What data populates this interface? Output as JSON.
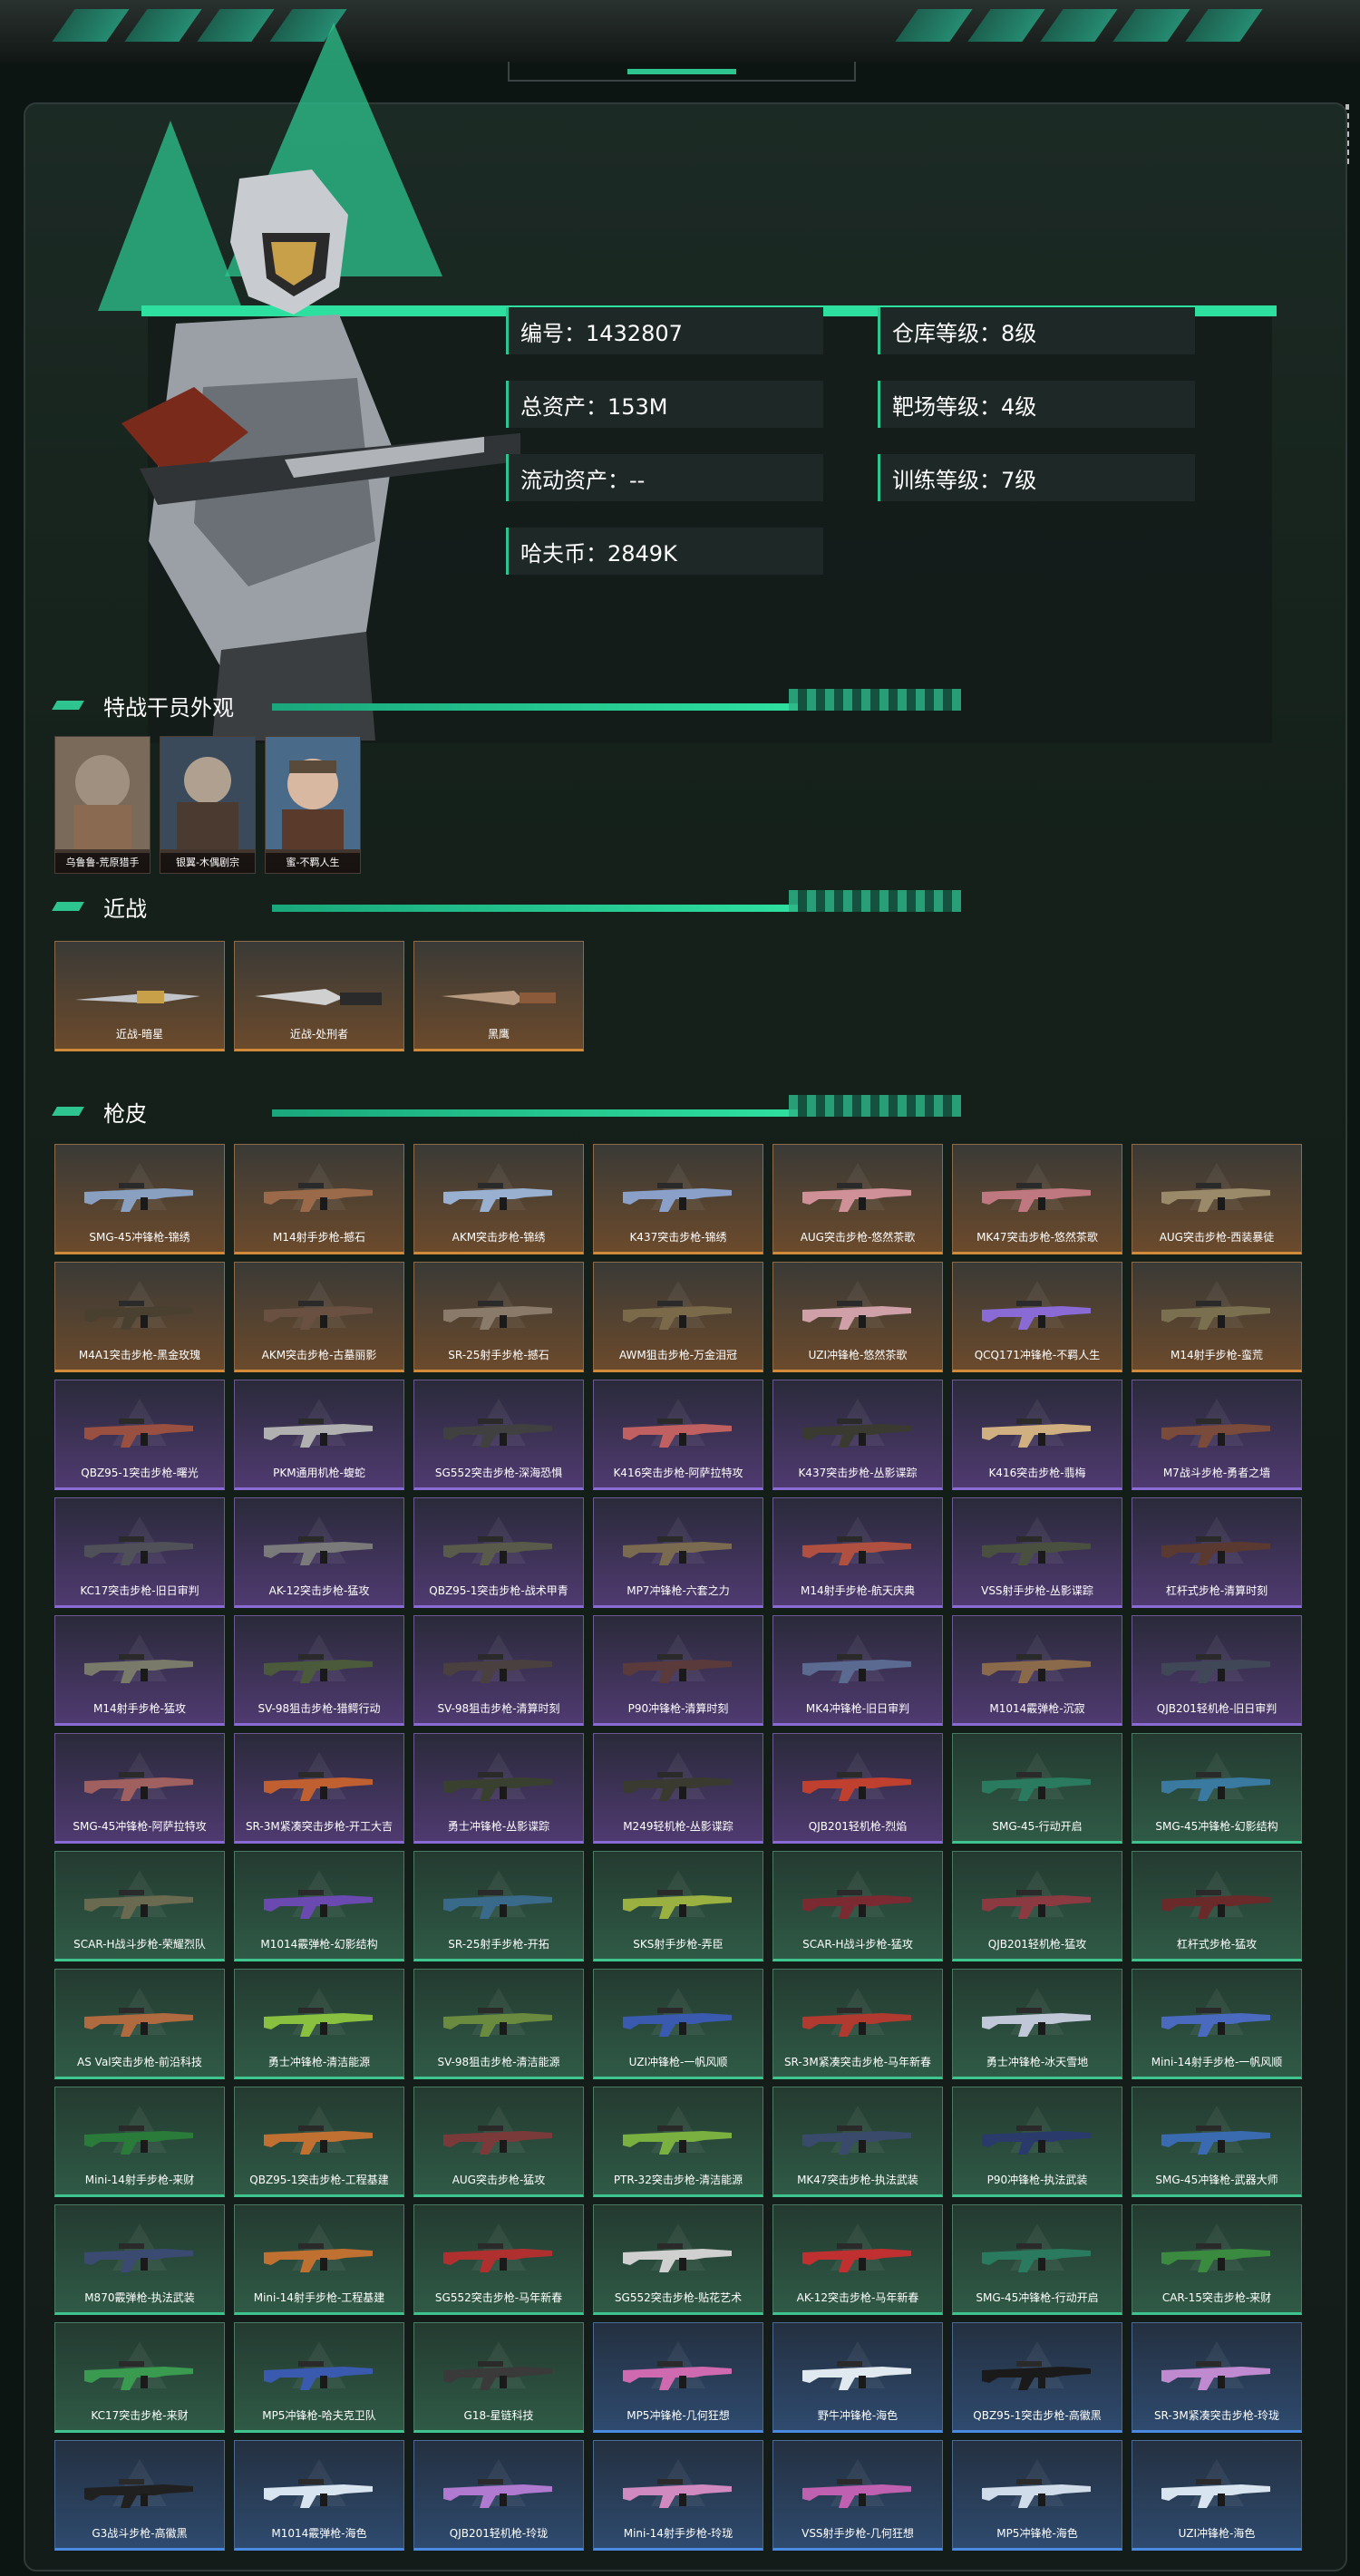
{
  "profile": {
    "stats_left": [
      "编号：1432807",
      "总资产：153M",
      "流动资产：--",
      "哈夫币：2849K"
    ],
    "stats_right": [
      "仓库等级：8级",
      "靶场等级：4级",
      "训练等级：7级"
    ]
  },
  "sections": {
    "operators": "特战干员外观",
    "melee": "近战",
    "skins": "枪皮"
  },
  "operators": [
    "乌鲁鲁-荒原猎手",
    "银翼-木偶剧宗",
    "蜜-不羁人生"
  ],
  "melee": [
    "近战-暗星",
    "近战-处刑者",
    "黑鹰"
  ],
  "skins": [
    {
      "name": "SMG-45冲锋枪-锦绣",
      "tier": "orange",
      "color": "#8aa0c0"
    },
    {
      "name": "M14射手步枪-撼石",
      "tier": "orange",
      "color": "#9a6a4a"
    },
    {
      "name": "AKM突击步枪-锦绣",
      "tier": "orange",
      "color": "#9ab0d0"
    },
    {
      "name": "K437突击步枪-锦绣",
      "tier": "orange",
      "color": "#8aa0c8"
    },
    {
      "name": "AUG突击步枪-悠然茶歌",
      "tier": "orange",
      "color": "#d09098"
    },
    {
      "name": "MK47突击步枪-悠然茶歌",
      "tier": "orange",
      "color": "#c07880"
    },
    {
      "name": "AUG突击步枪-西装暴徒",
      "tier": "orange",
      "color": "#9a8a6a"
    },
    {
      "name": "M4A1突击步枪-黑金玫瑰",
      "tier": "orange",
      "color": "#4a4030"
    },
    {
      "name": "AKM突击步枪-古墓丽影",
      "tier": "orange",
      "color": "#6a5040"
    },
    {
      "name": "SR-25射手步枪-撼石",
      "tier": "orange",
      "color": "#8a7a6a"
    },
    {
      "name": "AWM狙击步枪-万金泪冠",
      "tier": "orange",
      "color": "#7a6a4a"
    },
    {
      "name": "UZI冲锋枪-悠然茶歌",
      "tier": "orange",
      "color": "#d0a0a8"
    },
    {
      "name": "QCQ171冲锋枪-不羁人生",
      "tier": "orange",
      "color": "#8a6ad4"
    },
    {
      "name": "M14射手步枪-蛮荒",
      "tier": "orange",
      "color": "#7a7050"
    },
    {
      "name": "QBZ95-1突击步枪-曙光",
      "tier": "purple",
      "color": "#9a5040"
    },
    {
      "name": "PKM通用机枪-蝮蛇",
      "tier": "purple",
      "color": "#b0b0b0"
    },
    {
      "name": "SG552突击步枪-深海恐惧",
      "tier": "purple",
      "color": "#404040"
    },
    {
      "name": "K416突击步枪-阿萨拉特攻",
      "tier": "purple",
      "color": "#c06060"
    },
    {
      "name": "K437突击步枪-丛影谍踪",
      "tier": "purple",
      "color": "#3a3a30"
    },
    {
      "name": "K416突击步枪-翡梅",
      "tier": "purple",
      "color": "#d0b080"
    },
    {
      "name": "M7战斗步枪-勇者之墙",
      "tier": "purple",
      "color": "#7a4a3a"
    },
    {
      "name": "KC17突击步枪-旧日审判",
      "tier": "purple",
      "color": "#505058"
    },
    {
      "name": "AK-12突击步枪-猛攻",
      "tier": "purple",
      "color": "#7a7a7a"
    },
    {
      "name": "QBZ95-1突击步枪-战术甲青",
      "tier": "purple",
      "color": "#5a5a4a"
    },
    {
      "name": "MP7冲锋枪-六套之力",
      "tier": "purple",
      "color": "#7a6a50"
    },
    {
      "name": "M14射手步枪-航天庆典",
      "tier": "purple",
      "color": "#b05040"
    },
    {
      "name": "VSS射手步枪-丛影谍踪",
      "tier": "purple",
      "color": "#4a5040"
    },
    {
      "name": "杠杆式步枪-清算时刻",
      "tier": "purple",
      "color": "#5a3a30"
    },
    {
      "name": "M14射手步枪-猛攻",
      "tier": "purple",
      "color": "#7a7a6a"
    },
    {
      "name": "SV-98狙击步枪-猎鳄行动",
      "tier": "purple",
      "color": "#4a5a3a"
    },
    {
      "name": "SV-98狙击步枪-清算时刻",
      "tier": "purple",
      "color": "#4a4040"
    },
    {
      "name": "P90冲锋枪-清算时刻",
      "tier": "purple",
      "color": "#5a3a3a"
    },
    {
      "name": "MK4冲锋枪-旧日审判",
      "tier": "purple",
      "color": "#5a6a90"
    },
    {
      "name": "M1014霰弹枪-沉寂",
      "tier": "purple",
      "color": "#8a6a4a"
    },
    {
      "name": "QJB201轻机枪-旧日审判",
      "tier": "purple",
      "color": "#404858"
    },
    {
      "name": "SMG-45冲锋枪-阿萨拉特攻",
      "tier": "purple",
      "color": "#a06060"
    },
    {
      "name": "SR-3M紧凑突击步枪-开工大吉",
      "tier": "purple",
      "color": "#c06030"
    },
    {
      "name": "勇士冲锋枪-丛影谍踪",
      "tier": "purple",
      "color": "#3a4030"
    },
    {
      "name": "M249轻机枪-丛影谍踪",
      "tier": "purple",
      "color": "#3a3a30"
    },
    {
      "name": "QJB201轻机枪-烈焰",
      "tier": "purple",
      "color": "#c04030"
    },
    {
      "name": "SMG-45-行动开启",
      "tier": "green",
      "color": "#2a7a60"
    },
    {
      "name": "SMG-45冲锋枪-幻影结构",
      "tier": "green",
      "color": "#3a7aa0"
    },
    {
      "name": "SCAR-H战斗步枪-荣耀烈队",
      "tier": "green",
      "color": "#6a6a50"
    },
    {
      "name": "M1014霰弹枪-幻影结构",
      "tier": "green",
      "color": "#6a4ab0"
    },
    {
      "name": "SR-25射手步枪-开拓",
      "tier": "green",
      "color": "#3a6a8a"
    },
    {
      "name": "SKS射手步枪-弄臣",
      "tier": "green",
      "color": "#9ab040"
    },
    {
      "name": "SCAR-H战斗步枪-猛攻",
      "tier": "green",
      "color": "#7a2a30"
    },
    {
      "name": "QJB201轻机枪-猛攻",
      "tier": "green",
      "color": "#8a3a40"
    },
    {
      "name": "杠杆式步枪-猛攻",
      "tier": "green",
      "color": "#6a2a2a"
    },
    {
      "name": "AS Val突击步枪-前沿科技",
      "tier": "green",
      "color": "#b06a40"
    },
    {
      "name": "勇士冲锋枪-清洁能源",
      "tier": "green",
      "color": "#8ac040"
    },
    {
      "name": "SV-98狙击步枪-清洁能源",
      "tier": "green",
      "color": "#6a8a40"
    },
    {
      "name": "UZI冲锋枪-一帆风顺",
      "tier": "green",
      "color": "#3a5ab0"
    },
    {
      "name": "SR-3M紧凑突击步枪-马年新春",
      "tier": "green",
      "color": "#b03a30"
    },
    {
      "name": "勇士冲锋枪-冰天雪地",
      "tier": "green",
      "color": "#c0c8d8"
    },
    {
      "name": "Mini-14射手步枪-一帆风顺",
      "tier": "green",
      "color": "#4a6ac0"
    },
    {
      "name": "Mini-14射手步枪-来财",
      "tier": "green",
      "color": "#2a7a3a"
    },
    {
      "name": "QBZ95-1突击步枪-工程基建",
      "tier": "green",
      "color": "#c07030"
    },
    {
      "name": "AUG突击步枪-猛攻",
      "tier": "green",
      "color": "#7a3a3a"
    },
    {
      "name": "PTR-32突击步枪-清洁能源",
      "tier": "green",
      "color": "#7ab040"
    },
    {
      "name": "MK47突击步枪-执法武装",
      "tier": "green",
      "color": "#3a4a6a"
    },
    {
      "name": "P90冲锋枪-执法武装",
      "tier": "green",
      "color": "#2a3a6a"
    },
    {
      "name": "SMG-45冲锋枪-武器大师",
      "tier": "green",
      "color": "#3a6ab0"
    },
    {
      "name": "M870霰弹枪-执法武装",
      "tier": "green",
      "color": "#3a4a70"
    },
    {
      "name": "Mini-14射手步枪-工程基建",
      "tier": "green",
      "color": "#c07030"
    },
    {
      "name": "SG552突击步枪-马年新春",
      "tier": "green",
      "color": "#b03030"
    },
    {
      "name": "SG552突击步枪-贴花艺术",
      "tier": "green",
      "color": "#d0d0d0"
    },
    {
      "name": "AK-12突击步枪-马年新春",
      "tier": "green",
      "color": "#c03030"
    },
    {
      "name": "SMG-45冲锋枪-行动开启",
      "tier": "green",
      "color": "#2a7a60"
    },
    {
      "name": "CAR-15突击步枪-来财",
      "tier": "green",
      "color": "#3a8a40"
    },
    {
      "name": "KC17突击步枪-来财",
      "tier": "green",
      "color": "#3a9a50"
    },
    {
      "name": "MP5冲锋枪-哈夫克卫队",
      "tier": "green",
      "color": "#3a5ab0"
    },
    {
      "name": "G18-星链科技",
      "tier": "green",
      "color": "#3a3a3a"
    },
    {
      "name": "MP5冲锋枪-几何狂想",
      "tier": "blue",
      "color": "#d06ab0"
    },
    {
      "name": "野牛冲锋枪-海色",
      "tier": "blue",
      "color": "#e0e8f0"
    },
    {
      "name": "QBZ95-1突击步枪-高徽黑",
      "tier": "blue",
      "color": "#1a1a1a"
    },
    {
      "name": "SR-3M紧凑突击步枪-玲珑",
      "tier": "blue",
      "color": "#c08ad0"
    },
    {
      "name": "G3战斗步枪-高徽黑",
      "tier": "blue",
      "color": "#202020"
    },
    {
      "name": "M1014霰弹枪-海色",
      "tier": "blue",
      "color": "#d8e4f0"
    },
    {
      "name": "QJB201轻机枪-玲珑",
      "tier": "blue",
      "color": "#b07ad0"
    },
    {
      "name": "Mini-14射手步枪-玲珑",
      "tier": "blue",
      "color": "#d08ac0"
    },
    {
      "name": "VSS射手步枪-几何狂想",
      "tier": "blue",
      "color": "#c060b0"
    },
    {
      "name": "MP5冲锋枪-海色",
      "tier": "blue",
      "color": "#d0dcea"
    },
    {
      "name": "UZI冲锋枪-海色",
      "tier": "blue",
      "color": "#d8e4f0"
    }
  ]
}
